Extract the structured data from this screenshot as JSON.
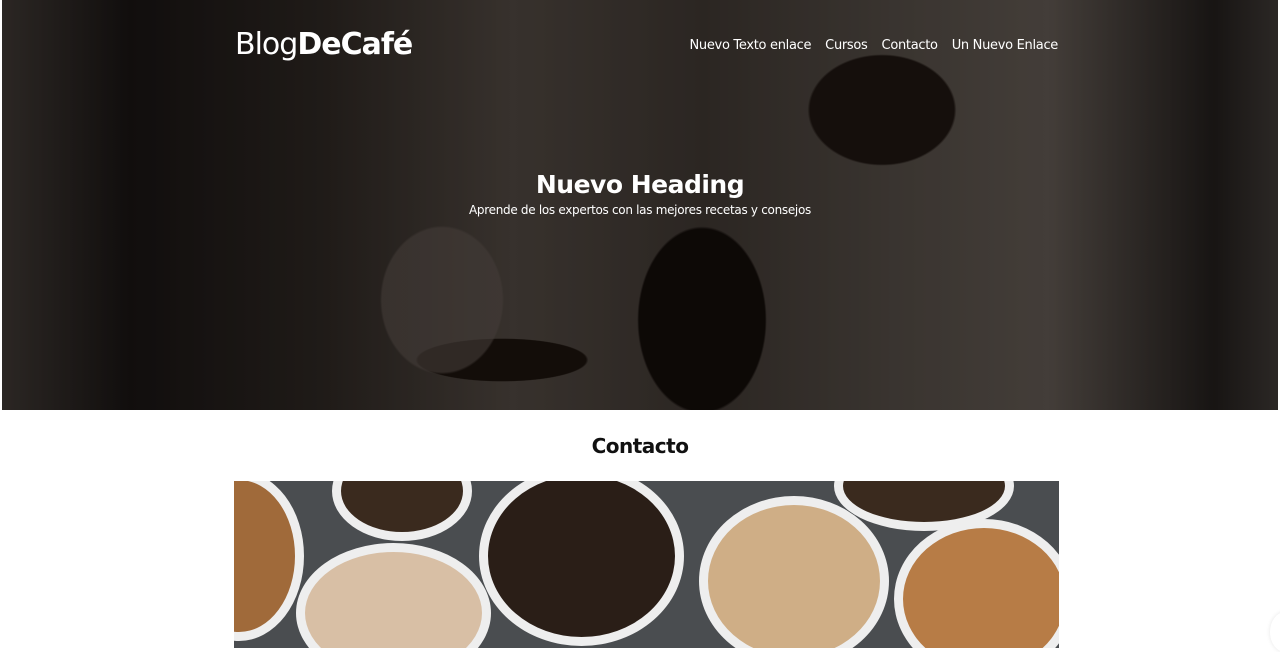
{
  "header": {
    "logo": {
      "part1": "Blog",
      "part2": "DeCafé"
    },
    "nav": [
      {
        "label": "Nuevo Texto enlace"
      },
      {
        "label": "Cursos"
      },
      {
        "label": "Contacto"
      },
      {
        "label": "Un Nuevo Enlace"
      }
    ]
  },
  "hero": {
    "heading": "Nuevo Heading",
    "subheading": "Aprende de los expertos con las mejores recetas y consejos"
  },
  "section": {
    "title": "Contacto"
  }
}
